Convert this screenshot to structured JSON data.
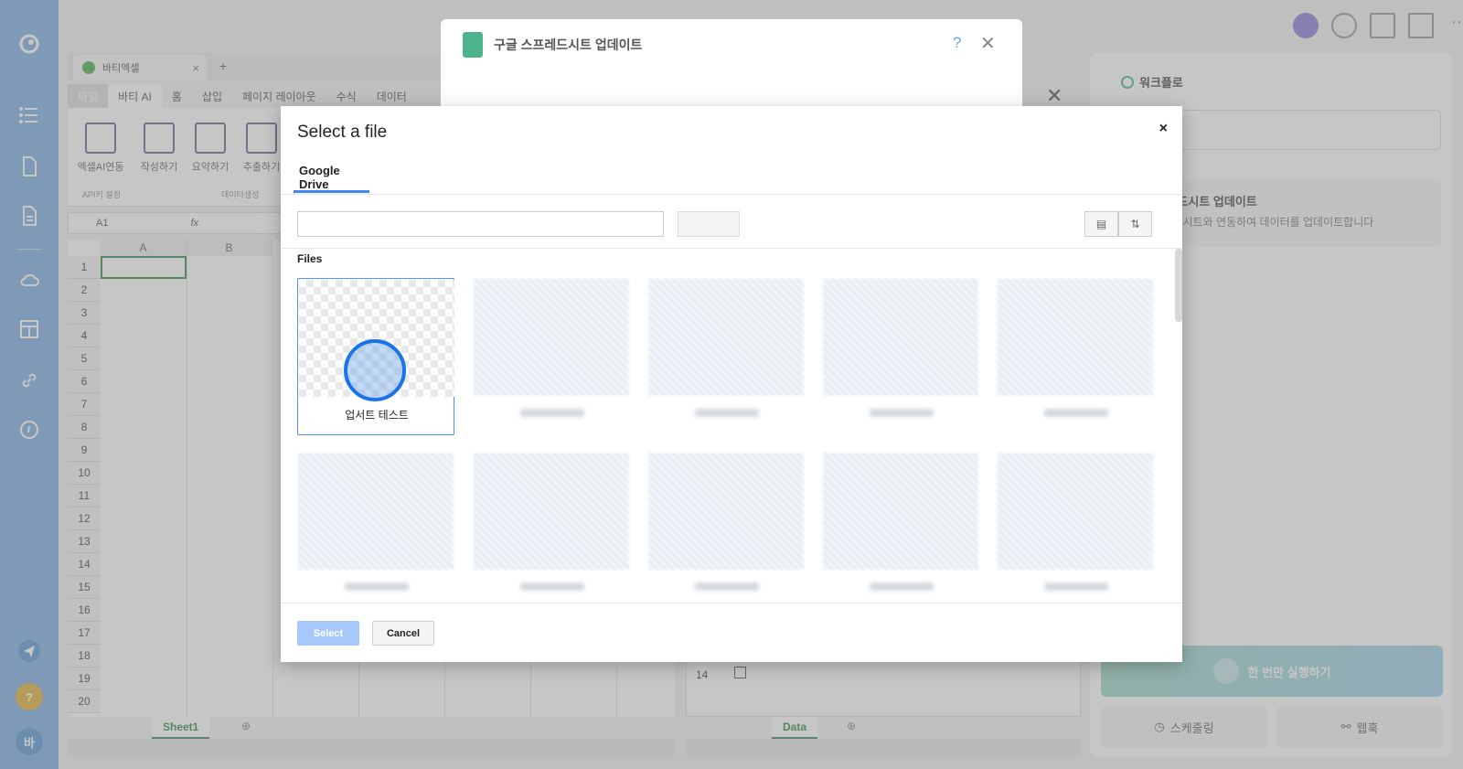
{
  "excel": {
    "tab_title": "바티엑셀",
    "menu": [
      "파일",
      "바티 AI",
      "홈",
      "삽입",
      "페이지 레이아웃",
      "수식",
      "데이터"
    ],
    "ribbon": [
      "엑셀AI연동",
      "작성하기",
      "요약하기",
      "추출하기"
    ],
    "ribbon_groups": [
      "API키 설정",
      "데이터생성"
    ],
    "cell_ref": "A1",
    "fx": "fx",
    "columns": [
      "A",
      "B"
    ],
    "rows": [
      "1",
      "2",
      "3",
      "4",
      "5",
      "6",
      "7",
      "8",
      "9",
      "10",
      "11",
      "12",
      "13",
      "14",
      "15",
      "16",
      "17",
      "18",
      "19",
      "20"
    ],
    "sheet": "Sheet1"
  },
  "mid_excel": {
    "row": "14",
    "sheet": "Data"
  },
  "workflow": {
    "title": "워크플로",
    "card_title": "구글 스프레드시트 업데이트",
    "card_desc": "구글 스프레드시트와 연동하여 데이터를 업데이트합니다",
    "run_label": "한 번만 실행하기",
    "schedule_label": "스케줄링",
    "webhook_label": "웹훅"
  },
  "gs_dialog": {
    "title": "구글 스프레드시트 업데이트",
    "help": "?",
    "close": "✕"
  },
  "picker": {
    "title": "Select a file",
    "close": "×",
    "tab": "Google Drive",
    "files_label": "Files",
    "files": [
      {
        "name": "업서트 테스트",
        "selected": true
      },
      {
        "name": "",
        "blurred": true
      },
      {
        "name": "",
        "blurred": true
      },
      {
        "name": "",
        "blurred": true
      },
      {
        "name": "",
        "blurred": true
      },
      {
        "name": "",
        "blurred": true
      },
      {
        "name": "",
        "blurred": true
      },
      {
        "name": "",
        "blurred": true
      },
      {
        "name": "",
        "blurred": true
      },
      {
        "name": "",
        "blurred": true
      }
    ],
    "select_label": "Select",
    "cancel_label": "Cancel"
  },
  "user_initial": "바",
  "help_glyph": "?"
}
